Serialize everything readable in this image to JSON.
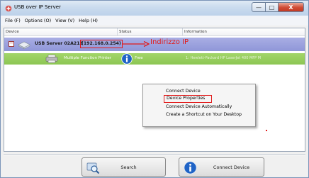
{
  "window": {
    "title": "USB over IP Server",
    "controls": {
      "minimize": "—",
      "maximize": "□",
      "close": "X"
    }
  },
  "menu": [
    {
      "label": "File (F)"
    },
    {
      "label": "Options (O)"
    },
    {
      "label": "View (V)"
    },
    {
      "label": "Help (H)"
    }
  ],
  "list": {
    "columns": [
      "Device",
      "Status",
      "Information"
    ],
    "server": {
      "expand": "−",
      "name": "USB Server 02A213",
      "ip": "(192.168.0.254)",
      "annotation": "Indirizzo IP"
    },
    "device": {
      "name": "Multiple Function Printer",
      "status": "Free",
      "information": "1: Hewlett-Packard HP LaserJet 400 MFP M"
    }
  },
  "context_menu": {
    "items": [
      {
        "label": "Connect Device"
      },
      {
        "label": "Device Properties"
      },
      {
        "label": "Connect Device Automatically"
      },
      {
        "label": "Create a Shortcut on Your Desktop"
      }
    ]
  },
  "buttons": {
    "search": "Search",
    "connect": "Connect Device"
  },
  "icons": {
    "app": "usb-app-icon",
    "server": "server-icon",
    "printer": "printer-icon",
    "status": "info-icon",
    "search": "magnifier-icon",
    "connect": "info-icon"
  },
  "colors": {
    "server_row": "#9aa0dc",
    "device_row": "#96cc5d",
    "annotation": "#e11b1b",
    "close_button": "#cf4a34"
  }
}
